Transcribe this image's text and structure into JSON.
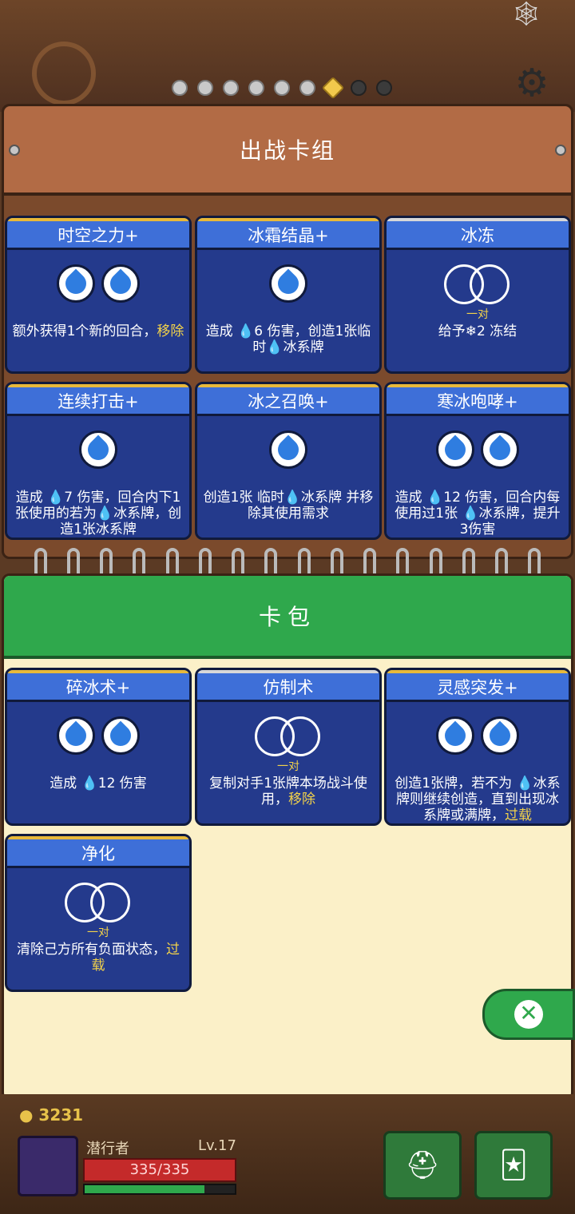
{
  "deck": {
    "title": "出战卡组",
    "cards": [
      {
        "name": "时空之力+",
        "frame": "gold",
        "cost": "drops2",
        "cost_label": "",
        "desc": "额外获得1个新的回合，",
        "desc_hl": "移除",
        "desc_tail": ""
      },
      {
        "name": "冰霜结晶+",
        "frame": "gold",
        "cost": "drops1",
        "cost_label": "",
        "desc": "造成 💧6 伤害，创造1张临时💧冰系牌",
        "desc_hl": "",
        "desc_tail": ""
      },
      {
        "name": "冰冻",
        "frame": "silver",
        "cost": "pair",
        "cost_label": "一对",
        "desc": "给予❄2 冻结",
        "desc_hl": "",
        "desc_tail": ""
      },
      {
        "name": "连续打击+",
        "frame": "gold",
        "cost": "drops1",
        "cost_label": "",
        "desc": "造成 💧7 伤害，回合内下1张使用的若为💧冰系牌，创造1张冰系牌",
        "desc_hl": "",
        "desc_tail": ""
      },
      {
        "name": "冰之召唤+",
        "frame": "gold",
        "cost": "drops1",
        "cost_label": "",
        "desc": "创造1张 临时💧冰系牌 并移除其使用需求",
        "desc_hl": "",
        "desc_tail": ""
      },
      {
        "name": "寒冰咆哮+",
        "frame": "gold",
        "cost": "drops2",
        "cost_label": "",
        "desc": "造成 💧12 伤害，回合内每使用过1张 💧冰系牌，提升3伤害",
        "desc_hl": "",
        "desc_tail": ""
      }
    ]
  },
  "pack": {
    "title": "卡包",
    "cards": [
      {
        "name": "碎冰术+",
        "frame": "gold",
        "cost": "drops2",
        "cost_label": "",
        "desc": "造成 💧12 伤害",
        "desc_hl": "",
        "desc_tail": ""
      },
      {
        "name": "仿制术",
        "frame": "silver",
        "cost": "pair",
        "cost_label": "一对",
        "desc": "复制对手1张牌本场战斗使用，",
        "desc_hl": "移除",
        "desc_tail": ""
      },
      {
        "name": "灵感突发+",
        "frame": "gold",
        "cost": "drops2",
        "cost_label": "",
        "desc": "创造1张牌，若不为 💧冰系牌则继续创造，直到出现冰系牌或满牌，",
        "desc_hl": "过载",
        "desc_tail": ""
      },
      {
        "name": "净化",
        "frame": "gold",
        "cost": "pair",
        "cost_label": "一对",
        "desc": "清除己方所有负面状态，",
        "desc_hl": "过载",
        "desc_tail": ""
      }
    ]
  },
  "player": {
    "coins": "3231",
    "name": "潜行者",
    "level": "Lv.17",
    "hp": "335/335",
    "xp_fraction": 0.8
  },
  "colors": {
    "card_bg": "#243a8c",
    "card_header": "#3e6fd8",
    "highlight": "#f2d24a",
    "pack_green": "#2fa84c"
  }
}
